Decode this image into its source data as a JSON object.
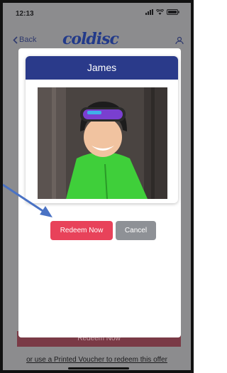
{
  "status_bar": {
    "time": "12:13"
  },
  "header": {
    "back_label": "Back",
    "brand": "coldisc"
  },
  "modal": {
    "title": "James",
    "redeem_label": "Redeem Now",
    "cancel_label": "Cancel"
  },
  "background": {
    "redeem_label": "Redeem Now",
    "voucher_text": "or use a Printed Voucher to redeem this offer"
  },
  "colors": {
    "header_blue": "#2a3a8a",
    "redeem_red": "#e8425a",
    "cancel_gray": "#8e9196",
    "arrow_blue": "#4a72c4"
  },
  "icons": [
    "location-arrow-icon",
    "signal-icon",
    "wifi-icon",
    "battery-icon",
    "chevron-left-icon",
    "profile-icon"
  ]
}
